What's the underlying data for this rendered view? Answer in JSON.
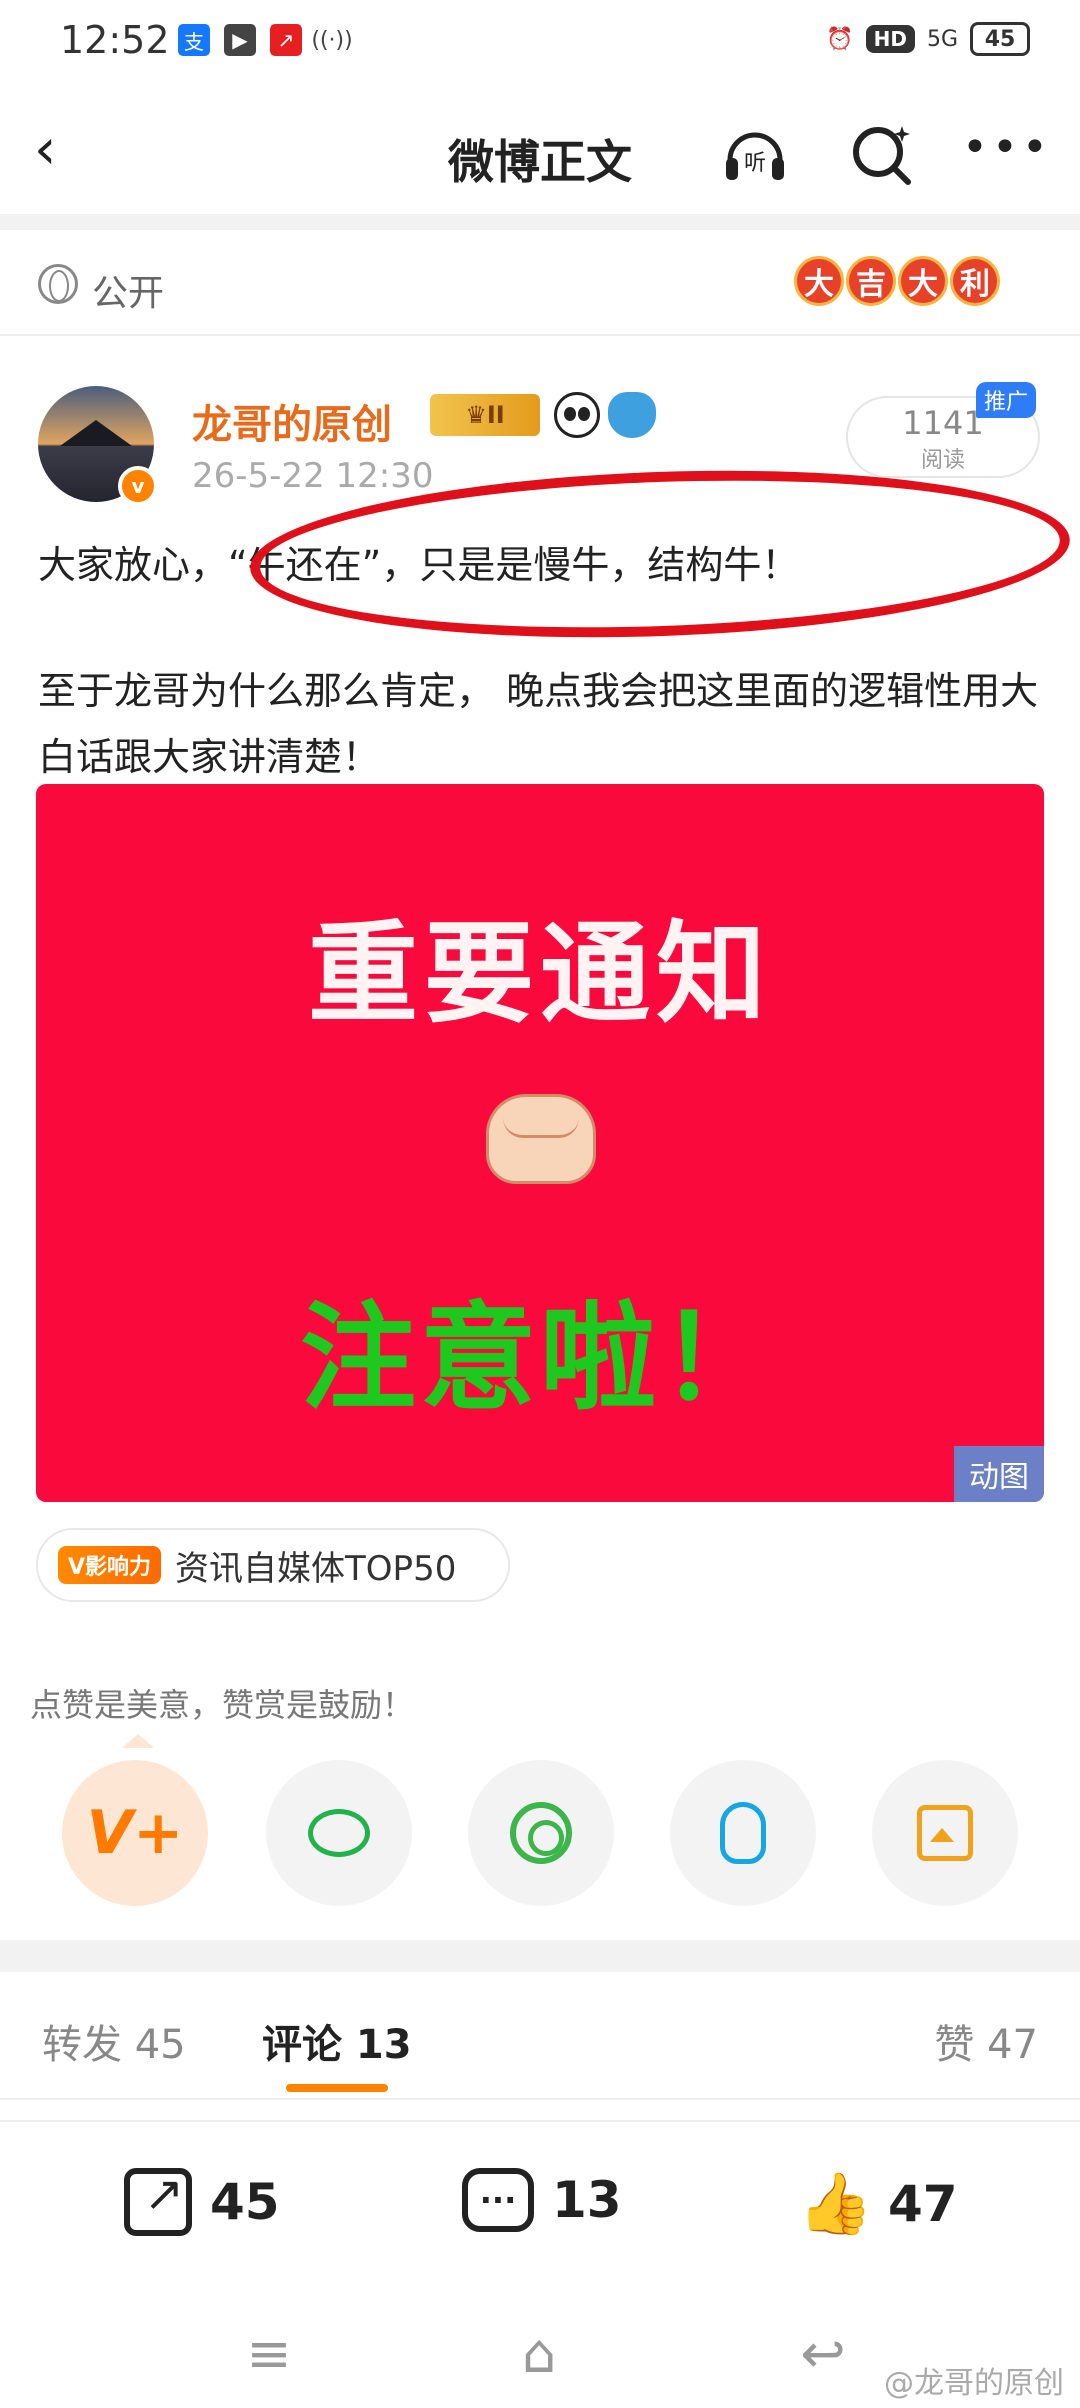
{
  "status_bar": {
    "time": "12:52",
    "left_icons": [
      "alipay-icon",
      "video-play-icon",
      "stock-app-icon",
      "hotspot-icon"
    ],
    "alarm": "alarm-icon",
    "hd": "HD",
    "network": "5G",
    "battery": "45"
  },
  "nav": {
    "title": "微博正文",
    "listen_label": "听"
  },
  "visibility": {
    "label": "公开",
    "badge": [
      "大",
      "吉",
      "大",
      "利"
    ]
  },
  "author": {
    "name": "龙哥的原创",
    "level_badge": "II",
    "time": "26-5-22 12:30",
    "read_count": "1141",
    "read_label": "阅读",
    "promo_tag": "推广",
    "verified": "v"
  },
  "post": {
    "line1": "大家放心，“牛还在”，只是是慢牛，结构牛！",
    "line2": "至于龙哥为什么那么肯定， 晚点我会把这里面的逻辑性用大白话跟大家讲清楚！"
  },
  "gif": {
    "title": "重要通知",
    "subtitle": "注意啦！",
    "tag": "动图"
  },
  "influence": {
    "logo": "V影响力",
    "text": "资讯自媒体TOP50"
  },
  "reward": {
    "text": "点赞是美意，赞赏是鼓励！",
    "v_label": "V+"
  },
  "tabs": {
    "repost": "转发 45",
    "comment": "评论 13",
    "like": "赞 47"
  },
  "actions": {
    "repost": "45",
    "comment": "13",
    "like": "47",
    "comment_glyph": "···"
  },
  "system_nav": {
    "watermark": "@龙哥的原创"
  }
}
